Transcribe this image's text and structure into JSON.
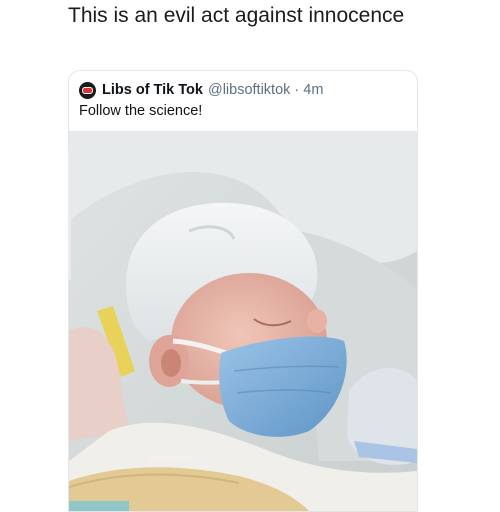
{
  "caption": "This is an evil act against innocence",
  "tweet": {
    "display_name": "Libs of Tik Tok",
    "handle": "@libsoftiktok",
    "separator": "·",
    "time": "4m",
    "text": "Follow the science!",
    "watermark": "@libsoftiktok"
  },
  "colors": {
    "mask": "#7fb0dc",
    "hat": "#f1f3f4",
    "blanket": "#e3ca94"
  },
  "icons": {
    "avatar": "libs-of-tiktok-avatar-icon"
  }
}
